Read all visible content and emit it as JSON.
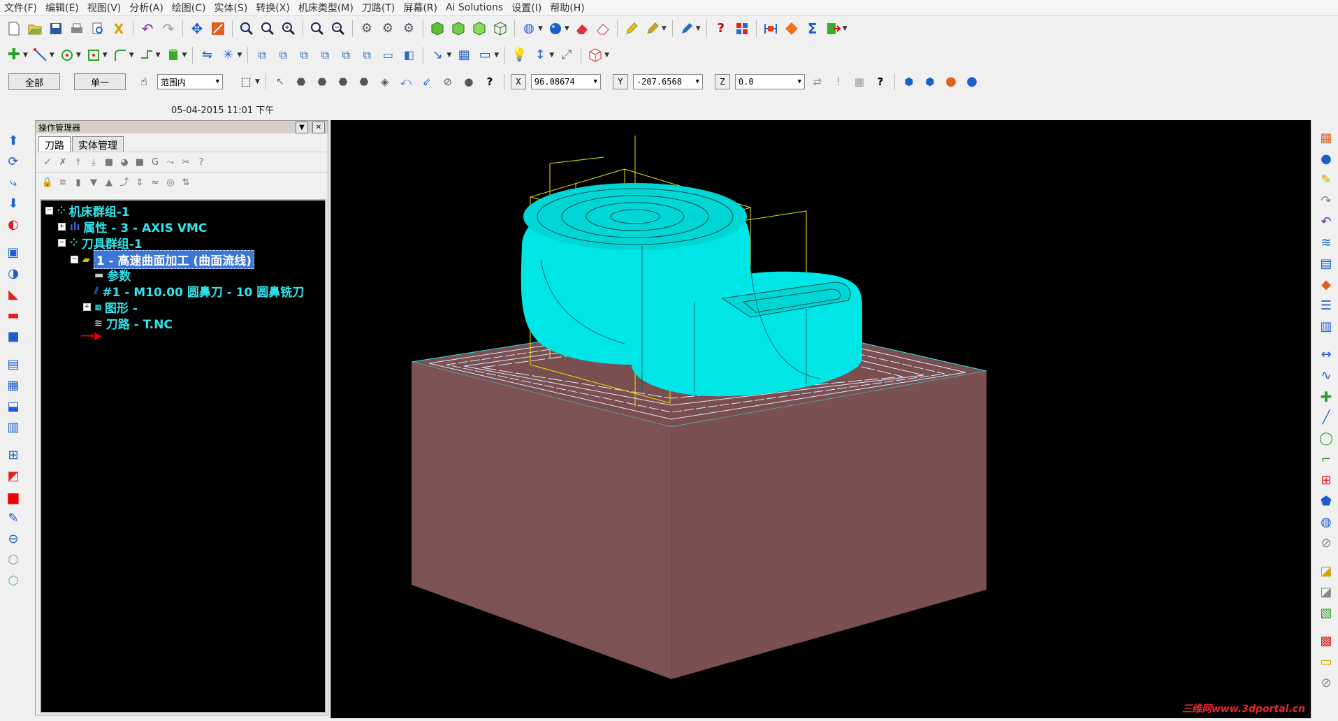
{
  "menu": [
    "文件(F)",
    "编辑(E)",
    "视图(V)",
    "分析(A)",
    "绘图(C)",
    "实体(S)",
    "转换(X)",
    "机床类型(M)",
    "刀路(T)",
    "屏幕(R)",
    "Ai Solutions",
    "设置(I)",
    "帮助(H)"
  ],
  "toolbar3": {
    "all_button": "全部",
    "single_button": "单一",
    "range_select": "范围内",
    "x_label": "X",
    "x_value": "96.08674",
    "y_label": "Y",
    "y_value": "-207.6568",
    "z_label": "Z",
    "z_value": "0.0"
  },
  "status": {
    "datetime": "05-04-2015 11:01  下午"
  },
  "op_manager": {
    "title": "操作管理器",
    "tabs": [
      "刀路",
      "实体管理"
    ],
    "tree": {
      "machine_group": "机床群组-1",
      "properties": "属性 - 3 - AXIS VMC",
      "toolpath_group": "刀具群组-1",
      "operation": "1 - 高速曲面加工 (曲面流线)",
      "params": "参数",
      "tool": "#1 - M10.00 圆鼻刀 - 10 圆鼻铣刀",
      "geometry": "图形 -",
      "toolpath": "刀路 - T.NC"
    }
  },
  "viewport": {
    "background": "#000000",
    "stock_color": "#7a4f4f",
    "toolpath_color": "#00e5e5",
    "wireframe_color": "#e6e600"
  },
  "watermark": "三维网www.3dportal.cn",
  "icons": [
    "new-file-icon",
    "open-folder-icon",
    "save-icon",
    "print-icon",
    "undo-icon",
    "redo-icon",
    "pan-icon",
    "zoom-icon",
    "sphere-icon",
    "cube-icon",
    "pencil-icon",
    "help-icon",
    "lightbulb-icon",
    "point-icon",
    "line-icon",
    "circle-icon"
  ]
}
